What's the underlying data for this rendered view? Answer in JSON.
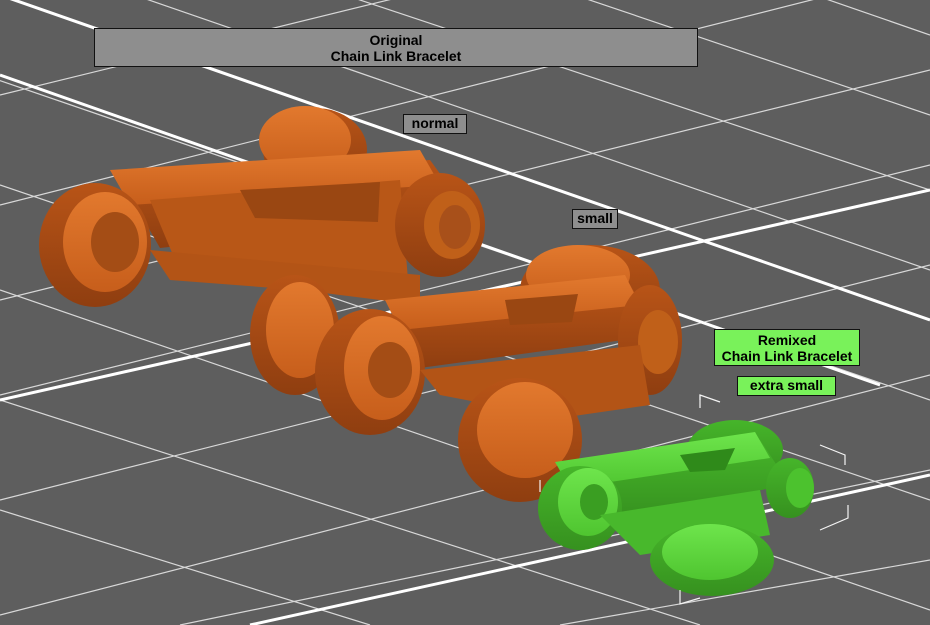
{
  "labels": {
    "original_line1": "Original",
    "original_line2": "Chain Link Bracelet",
    "normal": "normal",
    "small": "small",
    "remixed_line1": "Remixed",
    "remixed_line2": "Chain Link Bracelet",
    "extra_small": "extra small"
  },
  "colors": {
    "background": "#5e5e5e",
    "grid_minor": "#dcdcdc",
    "grid_major": "#ffffff",
    "original_part": "#d2671f",
    "remixed_part": "#5bd63a",
    "label_gray": "#8e8e8e",
    "label_green": "#79f25a"
  },
  "scene": {
    "original_sizes": [
      "normal",
      "small"
    ],
    "remixed_sizes": [
      "extra small"
    ]
  }
}
